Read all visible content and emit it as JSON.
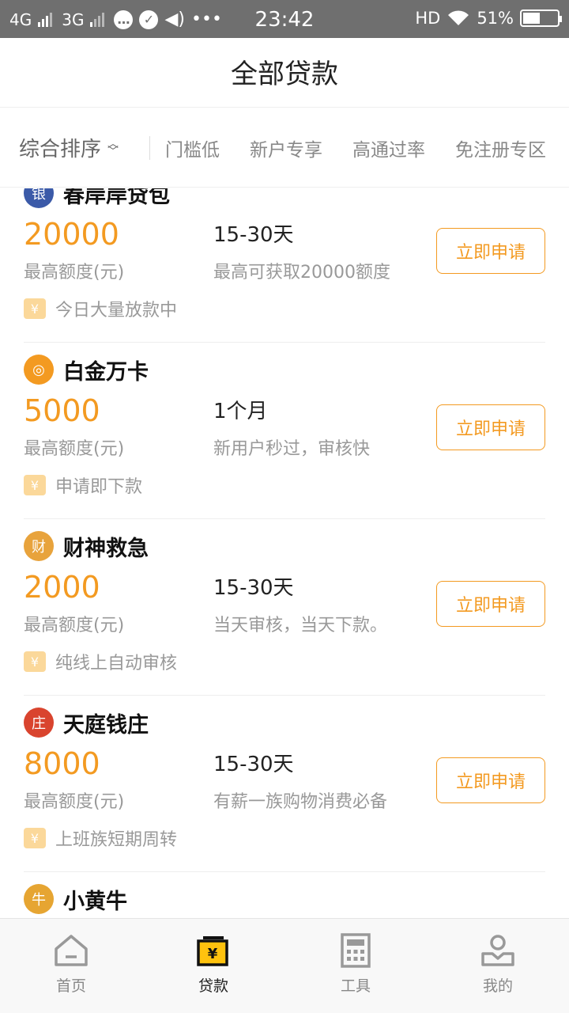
{
  "status_bar": {
    "net1": "4G",
    "net2": "3G",
    "time": "23:42",
    "hd": "HD",
    "battery": "51%",
    "battery_level": 0.51
  },
  "header": {
    "title": "全部贷款"
  },
  "filters": {
    "sort_label": "综合排序",
    "options": [
      "门槛低",
      "新户专享",
      "高通过率",
      "免注册专区"
    ]
  },
  "loans": [
    {
      "name": "春岸岸贷包",
      "amount": "20000",
      "amount_label": "最高额度(元)",
      "term": "15-30天",
      "desc": "最高可获取20000额度",
      "tag": "今日大量放款中",
      "apply": "立即申请",
      "logo_icon": "bank-icon",
      "logo_color": "#3b5aa8"
    },
    {
      "name": "白金万卡",
      "amount": "5000",
      "amount_label": "最高额度(元)",
      "term": "1个月",
      "desc": "新用户秒过，审核快",
      "tag": "申请即下款",
      "apply": "立即申请",
      "logo_icon": "coin-icon",
      "logo_color": "#f39a21"
    },
    {
      "name": "财神救急",
      "amount": "2000",
      "amount_label": "最高额度(元)",
      "term": "15-30天",
      "desc": "当天审核，当天下款。",
      "tag": "纯线上自动审核",
      "apply": "立即申请",
      "logo_icon": "fortune-god-icon",
      "logo_color": "#e8a33c"
    },
    {
      "name": "天庭钱庄",
      "amount": "8000",
      "amount_label": "最高额度(元)",
      "term": "15-30天",
      "desc": "有薪一族购物消费必备",
      "tag": "上班族短期周转",
      "apply": "立即申请",
      "logo_icon": "temple-icon",
      "logo_color": "#d9442e"
    },
    {
      "name": "小黄牛",
      "amount": "",
      "amount_label": "",
      "term": "",
      "desc": "",
      "tag": "",
      "apply": "",
      "logo_icon": "ox-icon",
      "logo_color": "#e6a532"
    }
  ],
  "bottom_nav": [
    {
      "label": "首页",
      "icon": "home-icon",
      "active": false
    },
    {
      "label": "贷款",
      "icon": "loan-icon",
      "active": true
    },
    {
      "label": "工具",
      "icon": "calculator-icon",
      "active": false
    },
    {
      "label": "我的",
      "icon": "profile-icon",
      "active": false
    }
  ],
  "colors": {
    "accent": "#f39a21",
    "nav_active": "#ffc20e"
  }
}
